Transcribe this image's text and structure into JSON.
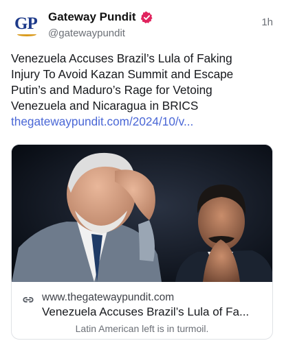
{
  "post": {
    "avatar_text": "GP",
    "display_name": "Gateway Pundit",
    "verified_icon": "verified-badge-icon",
    "handle": "@gatewaypundit",
    "timestamp": "1h",
    "text_lines": [
      "Venezuela Accuses Brazil’s Lula of Faking",
      "Injury To Avoid Kazan Summit and Escape",
      "Putin’s and Maduro’s Rage for Vetoing",
      "Venezuela and Nicaragua in BRICS"
    ],
    "link_text": "thegatewaypundit.com/2024/10/v..."
  },
  "link_card": {
    "image_icon": "news-photo-image",
    "link_icon": "link-icon",
    "domain": "www.thegatewaypundit.com",
    "title": "Venezuela Accuses Brazil’s Lula of Fa...",
    "description": "Latin American left is in turmoil."
  },
  "colors": {
    "link": "#4a67d6",
    "verified": "#e0245e",
    "logo_blue": "#1d3a8a",
    "logo_gold": "#d99a1c"
  }
}
